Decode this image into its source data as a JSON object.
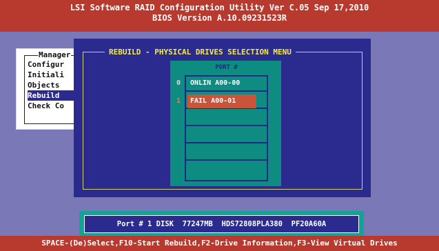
{
  "header": {
    "line1": "LSI Software RAID Configuration Utility Ver C.05 Sep 17,2010",
    "line2": "BIOS Version  A.10.09231523R"
  },
  "management_menu": {
    "title": "Manager",
    "items": [
      "Configur",
      "Initiali",
      "Objects",
      "Rebuild",
      "Check Co"
    ],
    "selected_index": 3
  },
  "rebuild_dialog": {
    "title": "REBUILD - PHYSICAL DRIVES SELECTION MENU",
    "column_header": "PORT #",
    "drives": [
      {
        "port": "0",
        "status": "ONLIN A00-00"
      },
      {
        "port": "1",
        "status": "FAIL A00-01"
      }
    ],
    "selected_index": 1
  },
  "info_box": {
    "text": "Port # 1 DISK  77247MB  HDS72808PLA380  PF20A60A"
  },
  "footer": {
    "hint": "SPACE-(De)Select,F10-Start Rebuild,F2-Drive Information,F3-View Virtual Drives"
  },
  "colors": {
    "background": "#7a78b7",
    "header_bar": "#b83a2e",
    "dialog": "#2b2a8e",
    "title_yellow": "#f4ec44",
    "list_teal": "#0f8c82",
    "fail_highlight": "#c8553a"
  }
}
